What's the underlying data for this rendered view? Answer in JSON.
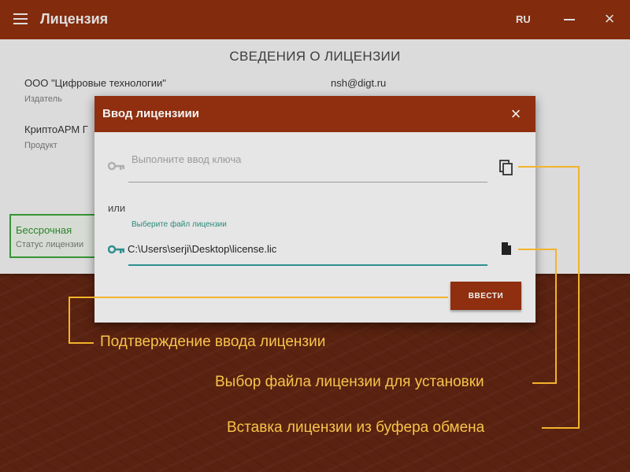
{
  "app": {
    "title": "Лицензия",
    "language": "RU",
    "minimize_label": "",
    "close_label": "×"
  },
  "license_info": {
    "section_title": "СВЕДЕНИЯ О ЛИЦЕНЗИИ",
    "publisher_value": "ООО \"Цифровые технологии\"",
    "publisher_label": "Издатель",
    "email_value": "nsh@digt.ru",
    "product_value": "КриптоАРМ Г",
    "product_label": "Продукт",
    "status_value": "Бессрочная",
    "status_label": "Статус лицензии"
  },
  "dialog": {
    "title": "Ввод лицензиии",
    "close_label": "×",
    "key_placeholder": "Выполните ввод ключа",
    "or_label": "или",
    "file_field_label": "Выберите файл лицензии",
    "file_path_value": "C:\\Users\\serji\\Desktop\\license.lic",
    "submit_label": "ВВЕСТИ"
  },
  "callouts": {
    "confirm": "Подтверждение ввода лицензии",
    "select_file": "Выбор файла лицензии для установки",
    "paste": "Вставка лицензии из буфера обмена"
  },
  "colors": {
    "title_bar": "#8f2f0f",
    "accent_teal": "#2f8f8f",
    "status_green": "#3aa23a",
    "callout": "#f2b32d"
  },
  "icons": [
    "menu-icon",
    "minimize-icon",
    "close-icon",
    "key-icon",
    "copy-icon",
    "file-icon"
  ]
}
